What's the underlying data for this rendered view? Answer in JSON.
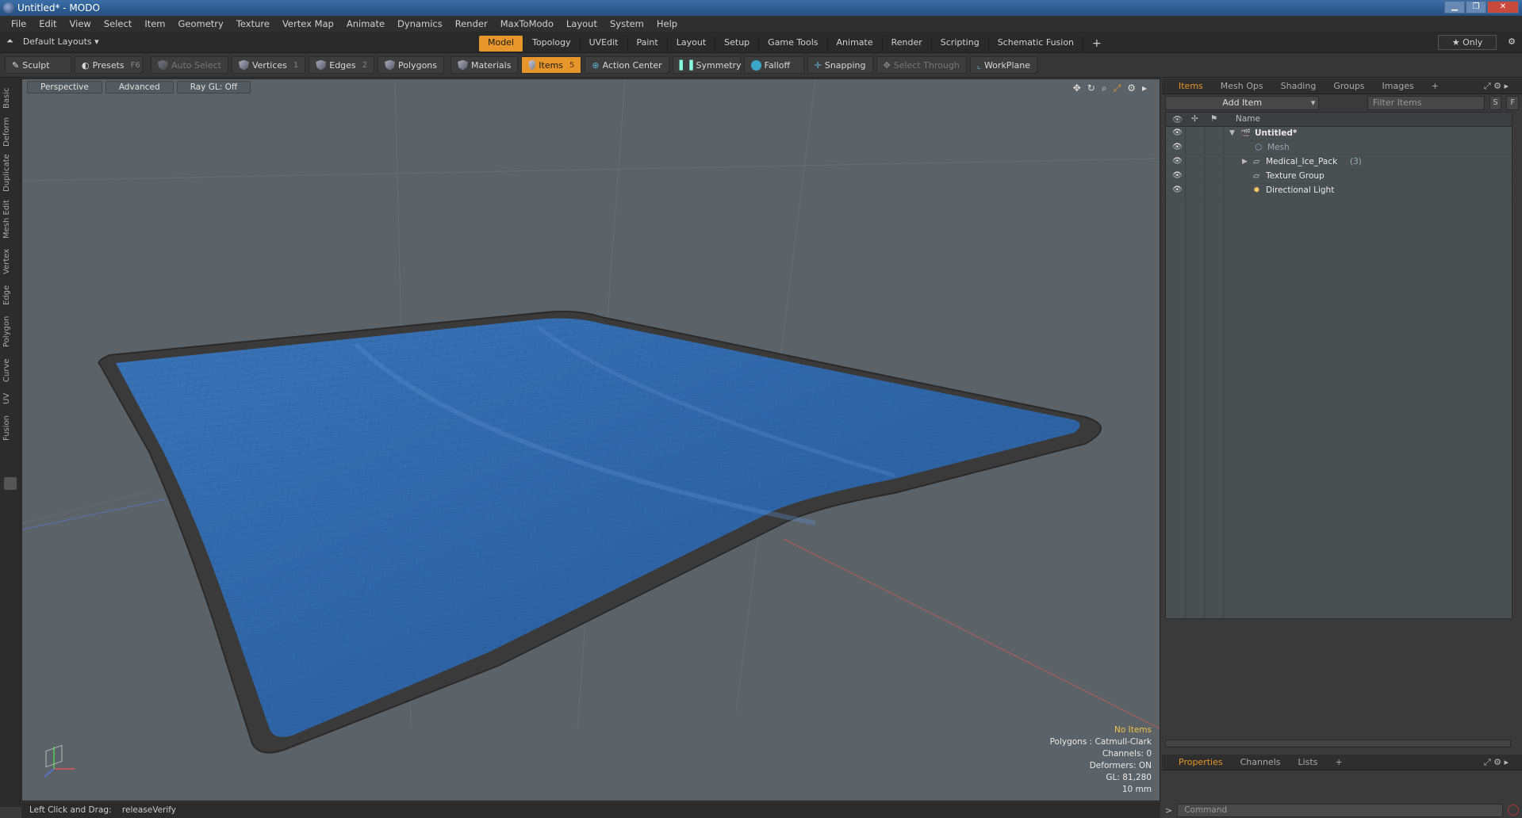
{
  "window": {
    "title": "Untitled* - MODO",
    "buttons": [
      "▁",
      "❐",
      "✕"
    ]
  },
  "menubar": [
    "File",
    "Edit",
    "View",
    "Select",
    "Item",
    "Geometry",
    "Texture",
    "Vertex Map",
    "Animate",
    "Dynamics",
    "Render",
    "MaxToModo",
    "Layout",
    "System",
    "Help"
  ],
  "layoutbar": {
    "layouts_label": "Default Layouts ▾",
    "tabs": [
      "Model",
      "Topology",
      "UVEdit",
      "Paint",
      "Layout",
      "Setup",
      "Game Tools",
      "Animate",
      "Render",
      "Scripting",
      "Schematic Fusion"
    ],
    "active_tab": "Model",
    "add": "+",
    "only": "★  Only",
    "gear": "⚙"
  },
  "toolbar": {
    "sculpt": "Sculpt",
    "presets": "Presets",
    "presets_key": "F6",
    "auto_select": "Auto Select",
    "vertices": "Vertices",
    "vertices_key": "1",
    "edges": "Edges",
    "edges_key": "2",
    "polygons": "Polygons",
    "materials": "Materials",
    "items": "Items",
    "items_key": "5",
    "action_center": "Action Center",
    "symmetry": "Symmetry",
    "falloff": "Falloff",
    "snapping": "Snapping",
    "select_through": "Select Through",
    "workplane": "WorkPlane"
  },
  "lefttabs": [
    "Basic",
    "Deform",
    "Duplicate",
    "Mesh Edit",
    "Vertex",
    "Edge",
    "Polygon",
    "Curve",
    "UV",
    "Fusion"
  ],
  "viewport": {
    "perspective": "Perspective",
    "advanced": "Advanced",
    "raygl": "Ray GL: Off",
    "info": {
      "no_items": "No Items",
      "polygons": "Polygons : Catmull-Clark",
      "channels": "Channels: 0",
      "deformers": "Deformers: ON",
      "gl": "GL: 81,280",
      "scale": "10 mm"
    },
    "colors": {
      "background": "#5b6368",
      "pack": "#2f66a8",
      "border": "#3a3a3a"
    }
  },
  "status": {
    "text": "Left Click and Drag:    releaseVerify"
  },
  "items_panel": {
    "tabs": [
      "Items",
      "Mesh Ops",
      "Shading",
      "Groups",
      "Images",
      "+"
    ],
    "active": "Items",
    "add_item": "Add Item",
    "filter_placeholder": "Filter Items",
    "s_btn": "S",
    "f_btn": "F",
    "col_name": "Name",
    "rows": [
      {
        "name": "Untitled*",
        "count": ""
      },
      {
        "name": "Mesh",
        "count": ""
      },
      {
        "name": "Medical_Ice_Pack",
        "count": "(3)"
      },
      {
        "name": "Texture Group",
        "count": ""
      },
      {
        "name": "Directional Light",
        "count": ""
      }
    ]
  },
  "props_panel": {
    "tabs": [
      "Properties",
      "Channels",
      "Lists",
      "+"
    ],
    "active": "Properties"
  },
  "command": {
    "placeholder": "Command"
  }
}
